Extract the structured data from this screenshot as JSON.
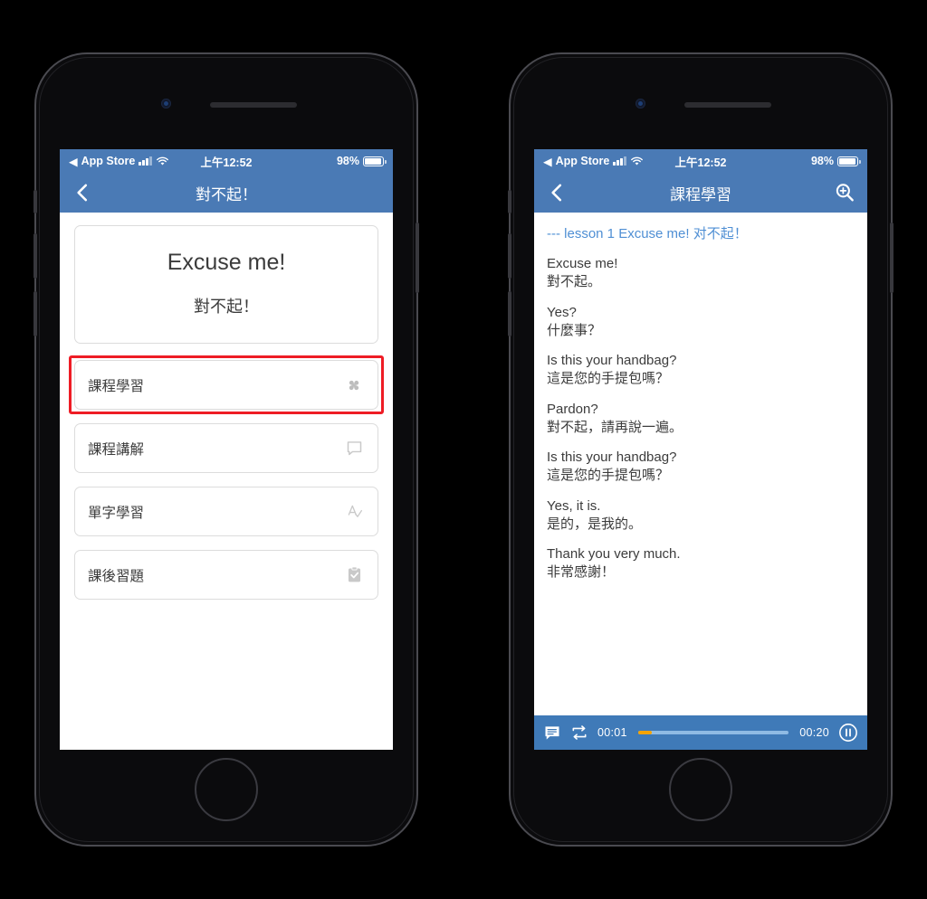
{
  "statusbar": {
    "carrier_label": "App Store",
    "time": "上午12:52",
    "battery_percent": "98%",
    "back_arrow": "◀"
  },
  "left_phone": {
    "navbar": {
      "title": "對不起！",
      "back_icon": "chevron-left-icon"
    },
    "card": {
      "english": "Excuse me!",
      "chinese": "對不起！"
    },
    "menu": [
      {
        "label": "課程學習",
        "icon": "pinwheel-icon",
        "selected": true
      },
      {
        "label": "課程講解",
        "icon": "speech-bubble-icon",
        "selected": false
      },
      {
        "label": "單字學習",
        "icon": "a-check-icon",
        "selected": false
      },
      {
        "label": "課後習題",
        "icon": "clipboard-check-icon",
        "selected": false
      }
    ],
    "highlight_color": "#ee1c25"
  },
  "right_phone": {
    "navbar": {
      "title": "課程學習",
      "back_icon": "chevron-left-icon",
      "search_icon": "zoom-in-icon"
    },
    "lesson_header": "--- lesson 1 Excuse me! 对不起！",
    "dialogue": [
      {
        "en": "Excuse me!",
        "zh": "對不起。"
      },
      {
        "en": "Yes?",
        "zh": "什麼事？"
      },
      {
        "en": "Is this your handbag?",
        "zh": "這是您的手提包嗎？"
      },
      {
        "en": "Pardon?",
        "zh": "對不起，請再說一遍。"
      },
      {
        "en": "Is this your handbag?",
        "zh": "這是您的手提包嗎？"
      },
      {
        "en": "Yes, it is.",
        "zh": "是的，是我的。"
      },
      {
        "en": "Thank you very much.",
        "zh": "非常感謝！"
      }
    ],
    "player": {
      "subtitle_icon": "subtitle-bubble-icon",
      "repeat_icon": "repeat-icon",
      "elapsed": "00:01",
      "total": "00:20",
      "progress_percent": 9,
      "play_state_icon": "pause-icon",
      "progress_color": "#f5a300",
      "track_color": "#8fbbe4"
    }
  },
  "theme": {
    "nav_blue": "#4a7ab5",
    "player_blue": "#3f7ab8",
    "lesson_link_blue": "#4f8fd4"
  }
}
